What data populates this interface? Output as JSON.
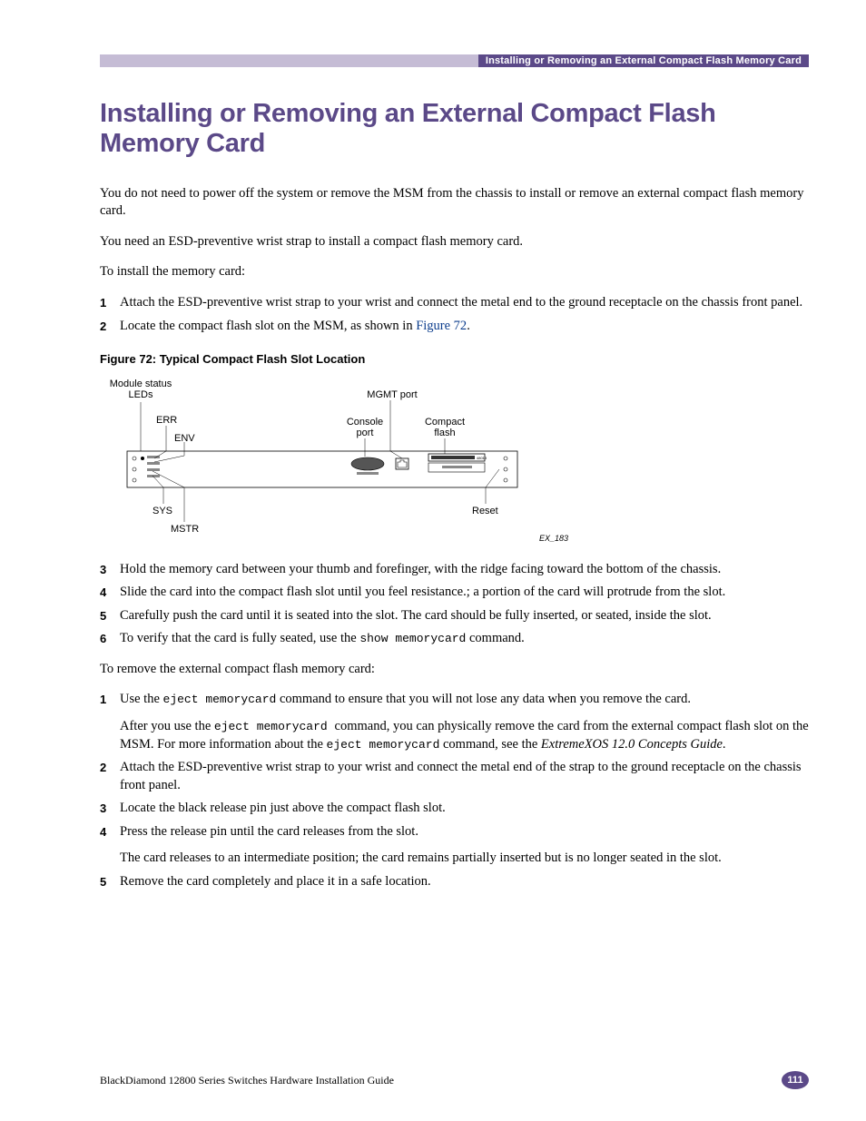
{
  "header": {
    "running_title": "Installing or Removing an External Compact Flash Memory Card"
  },
  "title": "Installing or Removing an External Compact Flash Memory Card",
  "intro": {
    "p1": "You do not need to power off the system or remove the MSM from the chassis to install or remove an external compact flash memory card.",
    "p2": "You need an ESD-preventive wrist strap to install a compact flash memory card.",
    "p3": "To install the memory card:"
  },
  "install_steps": [
    {
      "n": "1",
      "text": "Attach the ESD-preventive wrist strap to your wrist and connect the metal end to the ground receptacle on the chassis front panel."
    },
    {
      "n": "2",
      "pre": "Locate the compact flash slot on the MSM, as shown in ",
      "link": "Figure 72",
      "post": "."
    }
  ],
  "figure": {
    "caption": "Figure 72:  Typical Compact Flash Slot Location",
    "labels": {
      "module_status": "Module status LEDs",
      "err": "ERR",
      "env": "ENV",
      "sys": "SYS",
      "mstr": "MSTR",
      "mgmt": "MGMT port",
      "console": "Console port",
      "cf": "Compact flash",
      "reset": "Reset",
      "id": "EX_183"
    }
  },
  "install_steps_2": [
    {
      "n": "3",
      "text": "Hold the memory card between your thumb and forefinger, with the ridge facing toward the bottom of the chassis."
    },
    {
      "n": "4",
      "text": "Slide the card into the compact flash slot until you feel resistance.; a portion of the card will protrude from the slot."
    },
    {
      "n": "5",
      "text": "Carefully push the card until it is seated into the slot. The card should be fully inserted, or seated, inside the slot."
    },
    {
      "n": "6",
      "pre": "To verify that the card is fully seated, use the ",
      "code": "show memorycard",
      "post": " command."
    }
  ],
  "remove_intro": "To remove the external compact flash memory card:",
  "remove_steps": [
    {
      "n": "1",
      "p1_pre": "Use the ",
      "p1_code": "eject memorycard",
      "p1_post": " command to ensure that you will not lose any data when you remove the card.",
      "p2_pre": "After you use the ",
      "p2_code": "eject memorycard ",
      "p2_mid": " command, you can physically remove the card from the external compact flash slot on the MSM. For more information about the ",
      "p2_code2": "eject memorycard",
      "p2_post": " command, see the ",
      "p2_ital": "ExtremeXOS 12.0 Concepts Guide",
      "p2_end": "."
    },
    {
      "n": "2",
      "text": "Attach the ESD-preventive wrist strap to your wrist and connect the metal end of the strap to the ground receptacle on the chassis front panel."
    },
    {
      "n": "3",
      "text": "Locate the black release pin just above the compact flash slot."
    },
    {
      "n": "4",
      "p1": "Press the release pin until the card releases from the slot.",
      "p2": "The card releases to an intermediate position; the card remains partially inserted but is no longer seated in the slot."
    },
    {
      "n": "5",
      "text": "Remove the card completely and place it in a safe location."
    }
  ],
  "footer": {
    "book": "BlackDiamond 12800 Series Switches Hardware Installation Guide",
    "page": "111"
  }
}
